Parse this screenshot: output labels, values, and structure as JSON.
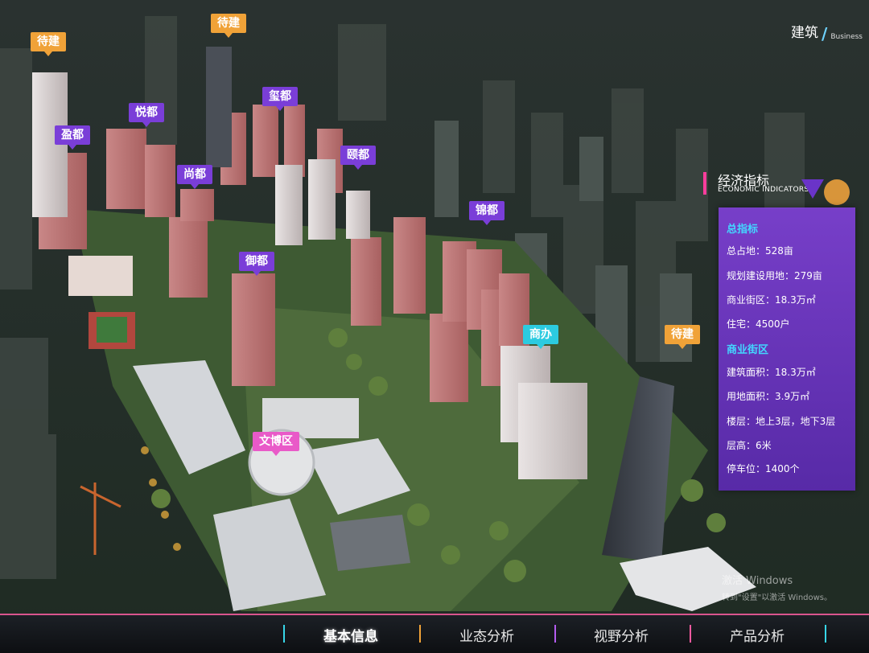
{
  "colors": {
    "tag_orange": "#f0a238",
    "tag_purple": "#7a3ed8",
    "tag_cyan": "#2ccbe0",
    "tag_pink": "#e95ac8",
    "panel_purple": "#7e40d6",
    "section_cyan": "#43d6ff",
    "separator_cyan": "#37d6e8",
    "separator_orange": "#f0a238",
    "separator_purple": "#b45cf0",
    "separator_pink": "#ff5aa0"
  },
  "brand": {
    "main": "建筑",
    "sub": "Business"
  },
  "map_tags": [
    {
      "label": "待建",
      "style": "orange"
    },
    {
      "label": "待建",
      "style": "orange"
    },
    {
      "label": "悦都",
      "style": "purple"
    },
    {
      "label": "盈都",
      "style": "purple"
    },
    {
      "label": "玺都",
      "style": "purple"
    },
    {
      "label": "尚都",
      "style": "purple"
    },
    {
      "label": "颐都",
      "style": "purple"
    },
    {
      "label": "锦都",
      "style": "purple"
    },
    {
      "label": "御都",
      "style": "purple"
    },
    {
      "label": "商办",
      "style": "cyan"
    },
    {
      "label": "待建",
      "style": "orange"
    },
    {
      "label": "文博区",
      "style": "pink"
    }
  ],
  "econ": {
    "title": "经济指标",
    "subtitle": "ECONOMIC INDICATORS",
    "section1": "总指标",
    "total_area": "总占地：528亩",
    "planned_land": "规划建设用地：279亩",
    "commercial_street": "商业街区：18.3万㎡",
    "housing": "住宅：4500户",
    "section2": "商业街区",
    "floor_area": "建筑面积：18.3万㎡",
    "land_area": "用地面积：3.9万㎡",
    "floors": "楼层：地上3层，地下3层",
    "height": "层高：6米",
    "parking": "停车位：1400个"
  },
  "watermark": {
    "line1": "激活 Windows",
    "line2": "转到\"设置\"以激活 Windows。"
  },
  "nav": {
    "items": [
      "基本信息",
      "业态分析",
      "视野分析",
      "产品分析"
    ],
    "active_index": 0
  }
}
